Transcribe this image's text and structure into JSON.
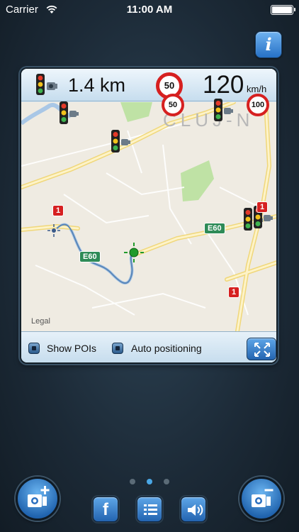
{
  "status_bar": {
    "carrier": "Carrier",
    "time": "11:00 AM"
  },
  "info_button": {
    "label": "i"
  },
  "radar_bar": {
    "icon": "traffic-light-camera-icon",
    "distance": "1.4 km",
    "speed_limit": "50",
    "speed": "120",
    "speed_unit": "km/h"
  },
  "map": {
    "city_label": "CLUJ-N",
    "road_labels": [
      "E60",
      "E60"
    ],
    "route_shields": [
      "1",
      "1",
      "1"
    ],
    "speed_signs": [
      "50",
      "100"
    ],
    "legal_label": "Legal",
    "colors": {
      "land": "#efebe2",
      "road": "#fdf3c8",
      "park": "#bfe2a5",
      "water": "#a9c7e6",
      "highway_shield": "#2e8b57",
      "route_shield": "#d62020"
    }
  },
  "options": {
    "show_pois_label": "Show POIs",
    "auto_positioning_label": "Auto positioning"
  },
  "pager": {
    "pages": 3,
    "active_index": 1
  },
  "bottom_buttons": {
    "add_camera": "add-camera-icon",
    "facebook": "f",
    "list": "list-icon",
    "sound": "speaker-icon",
    "remove_camera": "remove-camera-icon"
  },
  "accent_color": "#2a73c4"
}
